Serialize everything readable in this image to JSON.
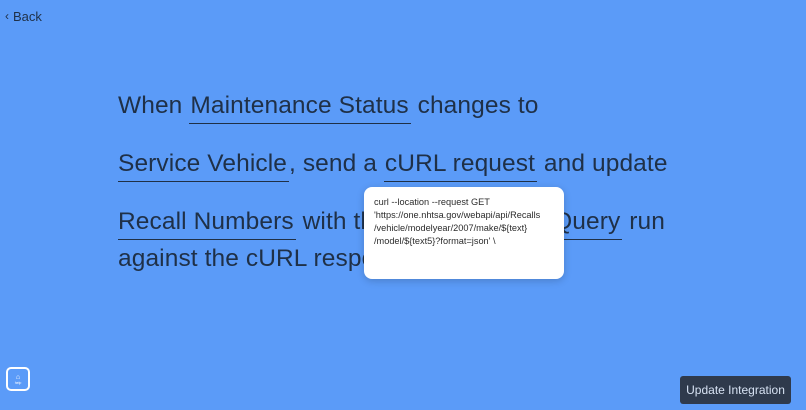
{
  "nav": {
    "back_label": "Back"
  },
  "sentence": {
    "when": "When",
    "trigger_field": "Maintenance Status",
    "changes_to": "changes to",
    "trigger_value": "Service Vehicle",
    "send_a": ", send a",
    "action": "cURL request",
    "and_update": "and update",
    "target_field": "Recall Numbers",
    "with_the": "with th",
    "query_fragment": "Query",
    "run": "run",
    "line4": "against the cURL respo"
  },
  "popover": {
    "lines": [
      "curl --location --request GET",
      "'https://one.nhtsa.gov/webapi/api/Recalls",
      "/vehicle/modelyear/2007/make/${text}",
      "/model/${text5}?format=json' \\"
    ]
  },
  "help": {
    "label": "help"
  },
  "footer": {
    "update_button": "Update Integration"
  },
  "colors": {
    "background": "#5b9bf8",
    "text": "#1f3047",
    "button_bg": "#2f3a4c"
  }
}
